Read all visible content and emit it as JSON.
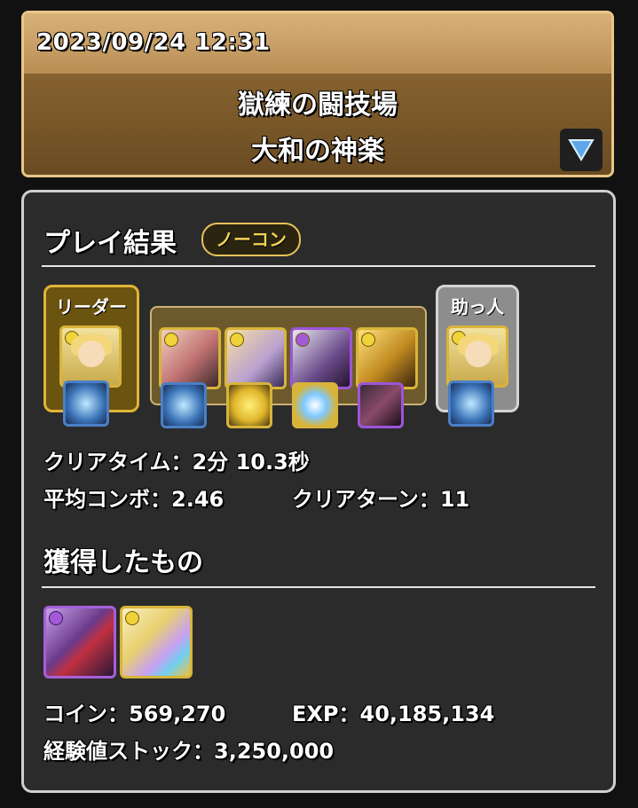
{
  "header": {
    "datetime": "2023/09/24 12:31",
    "dungeon_name": "獄練の闘技場",
    "floor_name": "大和の神楽"
  },
  "result": {
    "section_title": "プレイ結果",
    "badge": "ノーコン",
    "leader_label": "リーダー",
    "helper_label": "助っ人",
    "clear_time_label": "クリアタイム：",
    "clear_time_value": "2分 10.3秒",
    "avg_combo_label": "平均コンボ：",
    "avg_combo_value": "2.46",
    "clear_turns_label": "クリアターン：",
    "clear_turns_value": "11"
  },
  "team": {
    "leader": {
      "monster": "light-gold-girl",
      "assist": "blue-crystal-weapon"
    },
    "subs": [
      {
        "monster": "group-portrait",
        "assist": "blue-crystal-weapon"
      },
      {
        "monster": "blonde-witch",
        "assist": "yellow-round-creature"
      },
      {
        "monster": "silver-hair-dark",
        "assist": "yellow-orb"
      },
      {
        "monster": "gold-dragon",
        "assist": "dark-cube"
      }
    ],
    "helper": {
      "monster": "light-gold-girl",
      "assist": "blue-crystal-weapon"
    }
  },
  "obtained": {
    "section_title": "獲得したもの",
    "items": [
      "purple-demon-monster",
      "rainbow-egg-monster"
    ],
    "coin_label": "コイン：",
    "coin_value": "569,270",
    "exp_label": "EXP：",
    "exp_value": "40,185,134",
    "exp_stock_label": "経験値ストック：",
    "exp_stock_value": "3,250,000"
  },
  "colors": {
    "header_top": "#c9a06a",
    "header_bottom": "#7a5828",
    "panel_bg": "#2b2b2b",
    "leader_frame": "#e0b437",
    "helper_frame": "#d4d4d4",
    "badge": "#e6c15a"
  }
}
